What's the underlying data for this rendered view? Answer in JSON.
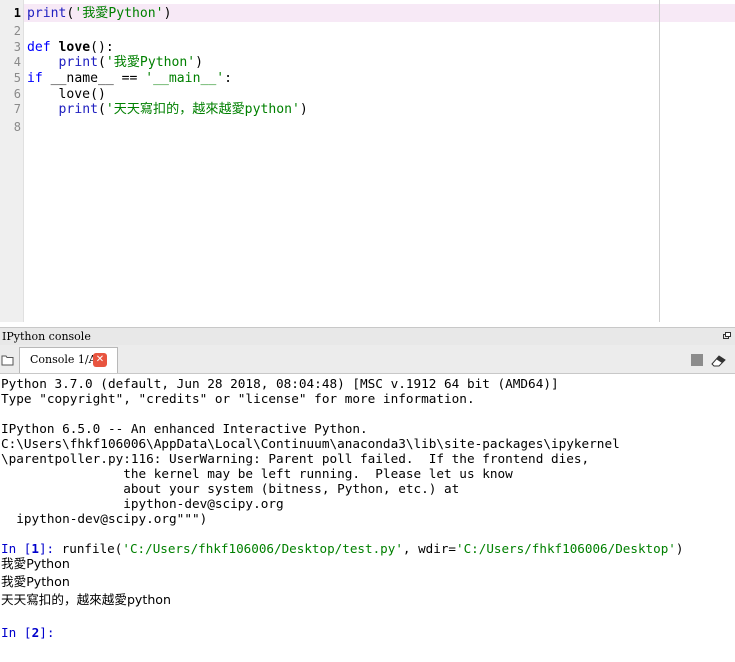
{
  "editor": {
    "line_numbers": [
      "1",
      "2",
      "3",
      "4",
      "5",
      "6",
      "7",
      "8"
    ],
    "lines": {
      "l1_print": "print",
      "l1_open": "(",
      "l1_str": "'我愛Python'",
      "l1_close": ")",
      "l3_def": "def",
      "l3_name": "love",
      "l3_rest": "():",
      "l4_indent": "    ",
      "l4_print": "print",
      "l4_open": "(",
      "l4_str": "'我愛Python'",
      "l4_close": ")",
      "l5_if": "if",
      "l5_mid": " __name__ == ",
      "l5_str": "'__main__'",
      "l5_colon": ":",
      "l6_text": "    love()",
      "l7_indent": "    ",
      "l7_print": "print",
      "l7_open": "(",
      "l7_str": "'天天寫扣的，越來越愛python'",
      "l7_close": ")"
    }
  },
  "console": {
    "pane_title": "IPython console",
    "tab_label": "Console 1/A",
    "tab_close": "✕",
    "output": {
      "banner1": "Python 3.7.0 (default, Jun 28 2018, 08:04:48) [MSC v.1912 64 bit (AMD64)]",
      "banner2": "Type \"copyright\", \"credits\" or \"license\" for more information.",
      "ipy1": "IPython 6.5.0 -- An enhanced Interactive Python.",
      "ipy2": "C:\\Users\\fhkf106006\\AppData\\Local\\Continuum\\anaconda3\\lib\\site-packages\\ipykernel",
      "ipy3": "\\parentpoller.py:116: UserWarning: Parent poll failed.  If the frontend dies,",
      "ipy4": "                the kernel may be left running.  Please let us know",
      "ipy5": "                about your system (bitness, Python, etc.) at",
      "ipy6": "                ipython-dev@scipy.org",
      "ipy7": "  ipython-dev@scipy.org\"\"\")",
      "in1_prefix": "In [",
      "in1_num": "1",
      "in1_suffix": "]: ",
      "in1_cmd": "runfile(",
      "in1_arg1": "'C:/Users/fhkf106006/Desktop/test.py'",
      "in1_mid": ", wdir=",
      "in1_arg2": "'C:/Users/fhkf106006/Desktop'",
      "in1_close": ")",
      "out1": "我愛Python",
      "out2": "我愛Python",
      "out3": "天天寫扣的，越來越愛python",
      "in2_prefix": "In [",
      "in2_num": "2",
      "in2_suffix": "]:"
    }
  },
  "icons": {
    "undock": "undock-icon",
    "browse_tabs": "browse-tabs-icon",
    "tab_close": "close-icon",
    "stop": "stop-icon",
    "clear": "eraser-icon"
  },
  "colors": {
    "current_line": "#f7e9f6",
    "keyword": "#0000ff",
    "string": "#008000",
    "prompt": "#0000cc",
    "close_button": "#e8543f"
  }
}
